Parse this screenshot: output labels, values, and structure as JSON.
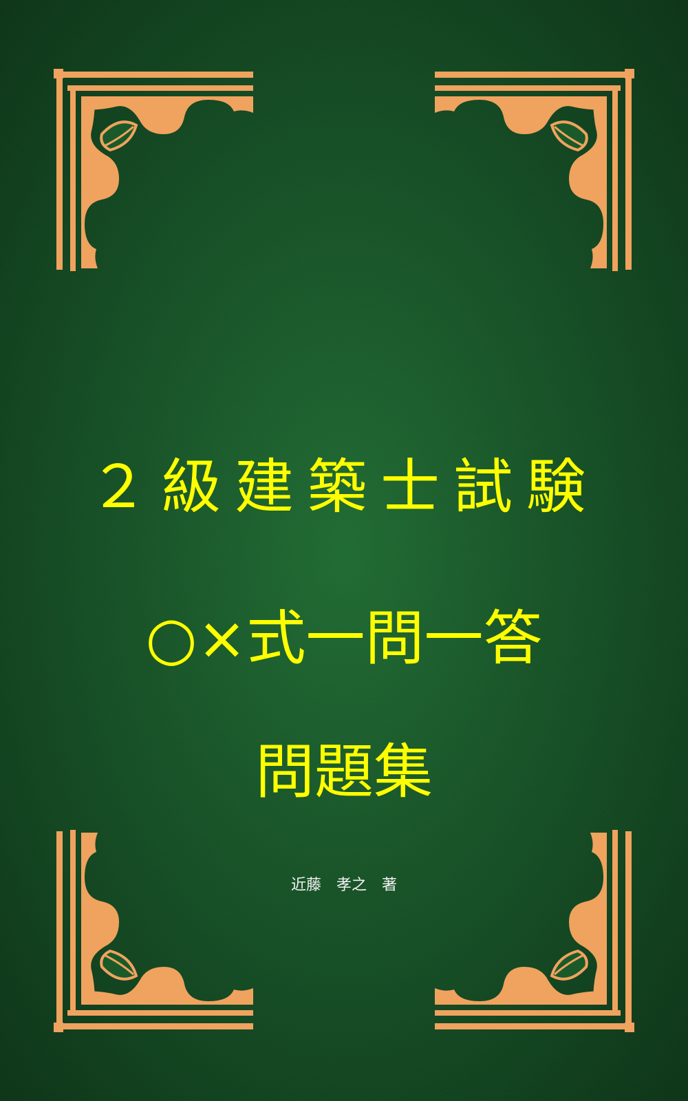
{
  "cover": {
    "title_line_1": "２級建築士試験",
    "title_line_2": "○×式一問一答",
    "title_line_3": "問題集",
    "author": "近藤　孝之　著"
  },
  "colors": {
    "background": "#165226",
    "title": "#ffff00",
    "ornament": "#f0a35e",
    "author": "#f2f2f2"
  },
  "icons": {
    "corner_ornament": "ornate-corner-bracket-icon"
  }
}
